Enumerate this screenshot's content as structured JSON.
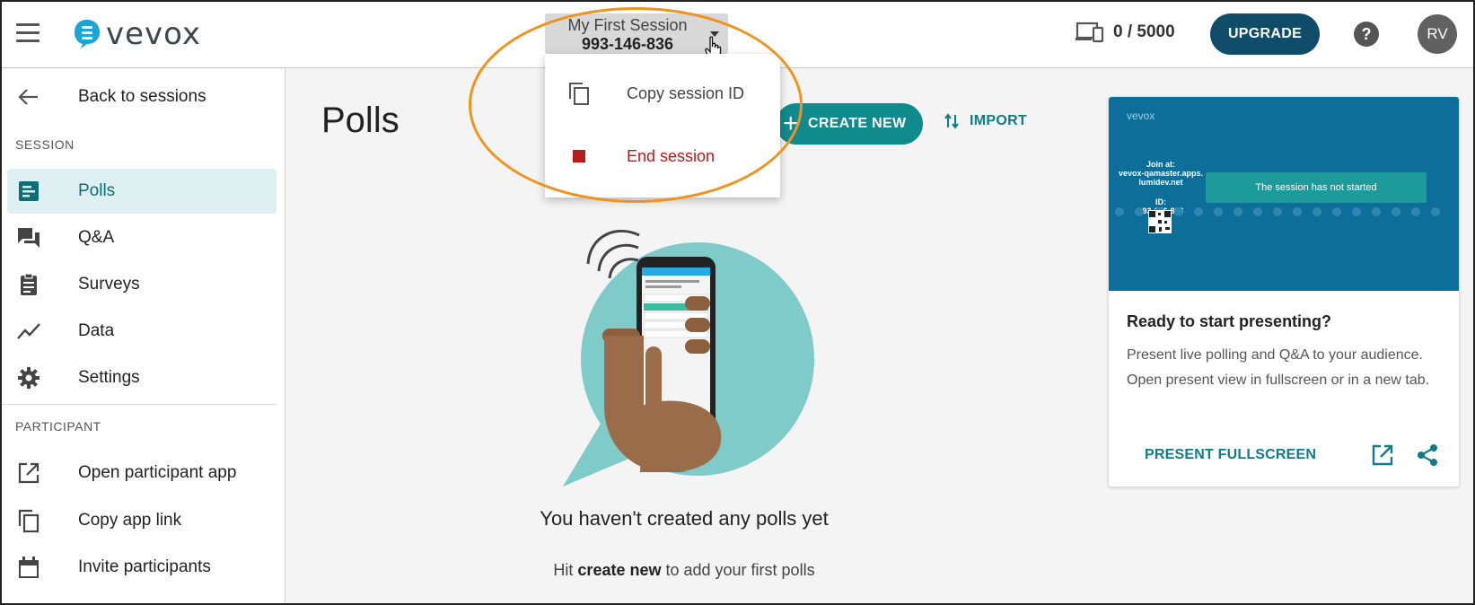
{
  "app": {
    "logo_text": "vevox"
  },
  "header": {
    "session_name": "My First Session",
    "session_id": "993-146-836",
    "devices_count": "0 / 5000",
    "upgrade_label": "UPGRADE",
    "help_label": "?",
    "avatar_initials": "RV"
  },
  "session_menu": {
    "copy_label": "Copy session ID",
    "end_label": "End session"
  },
  "sidebar": {
    "back_label": "Back to sessions",
    "session_heading": "SESSION",
    "items": [
      {
        "label": "Polls",
        "icon": "polls-icon",
        "active": true
      },
      {
        "label": "Q&A",
        "icon": "qa-icon"
      },
      {
        "label": "Surveys",
        "icon": "surveys-icon"
      },
      {
        "label": "Data",
        "icon": "data-icon"
      },
      {
        "label": "Settings",
        "icon": "settings-icon"
      }
    ],
    "participant_heading": "PARTICIPANT",
    "participant_items": [
      {
        "label": "Open participant app",
        "icon": "open-external-icon"
      },
      {
        "label": "Copy app link",
        "icon": "copy-icon"
      },
      {
        "label": "Invite participants",
        "icon": "calendar-icon"
      }
    ]
  },
  "main": {
    "title": "Polls",
    "create_label": "CREATE NEW",
    "import_label": "IMPORT",
    "empty_title": "You haven't created any polls yet",
    "empty_sub_prefix": "Hit ",
    "empty_sub_bold": "create new",
    "empty_sub_suffix": " to add your first polls"
  },
  "preview_card": {
    "preview_logo": "vevox",
    "preview_join_line1": "Join at:",
    "preview_join_line2": "vevox-qamaster.apps.",
    "preview_join_line3": "lumidev.net",
    "preview_id_label": "ID:",
    "preview_id_value": "993-146-836",
    "preview_status": "The session has not started",
    "title": "Ready to start presenting?",
    "description": "Present live polling and Q&A to your audience. Open present view in fullscreen or in a new tab.",
    "present_label": "PRESENT FULLSCREEN"
  },
  "colors": {
    "teal": "#0f8b8d",
    "navy": "#0f4d6b",
    "danger": "#b71c1c",
    "highlight_ring": "#f0931e"
  }
}
